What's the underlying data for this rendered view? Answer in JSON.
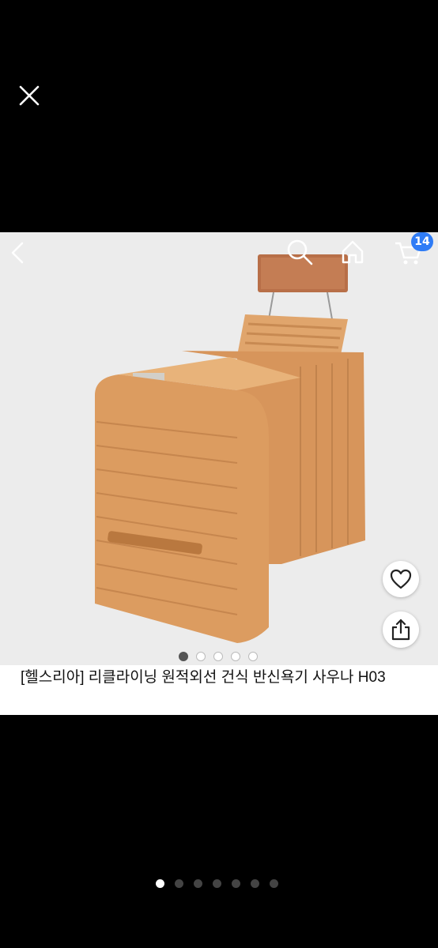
{
  "viewer": {
    "close_icon": "close-icon",
    "pager": {
      "count": 7,
      "active_index": 0
    }
  },
  "product": {
    "title": "[헬스리아] 리클라이닝 원적외선 건식 반신욕기 사우나 H03",
    "image_icons": {
      "back": "chevron-left-icon",
      "search": "search-icon",
      "home": "home-icon",
      "cart": "cart-icon"
    },
    "cart_badge": "14",
    "image_dots": {
      "count": 5,
      "active_index": 0
    },
    "favorite_icon": "heart-icon",
    "share_icon": "share-icon",
    "colors": {
      "badge": "#2f7cf6",
      "wood": "#d99a5e"
    }
  }
}
